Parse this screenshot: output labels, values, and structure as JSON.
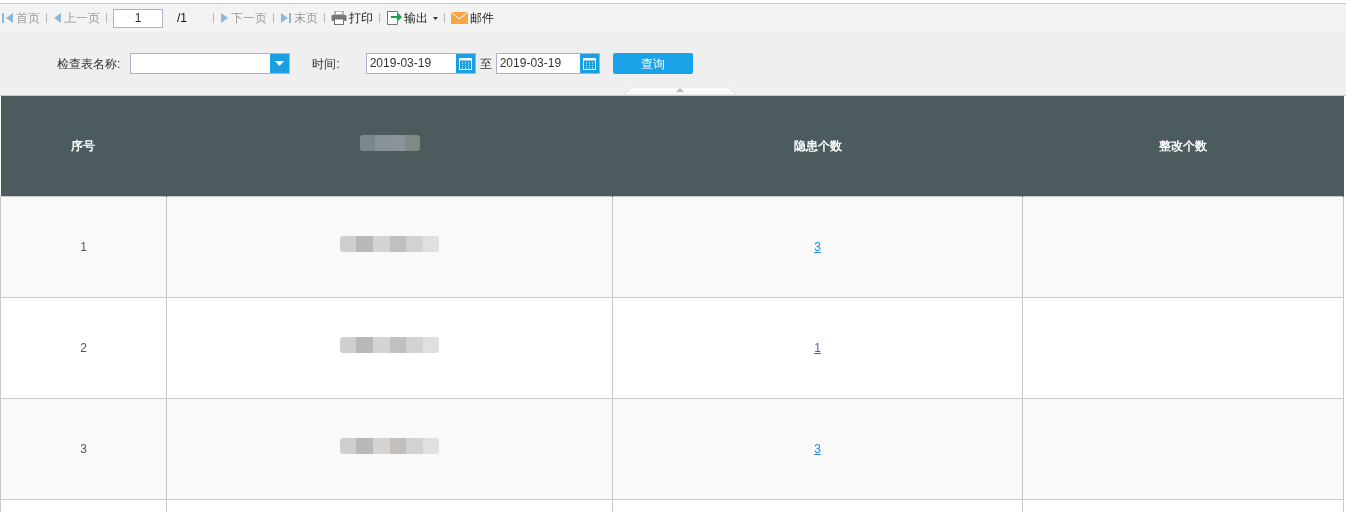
{
  "toolbar": [
    {
      "kind": "first",
      "label": "首页",
      "disabled": true
    },
    {
      "kind": "prev",
      "label": "上一页",
      "disabled": true
    },
    {
      "kind": "page",
      "value": "1",
      "total": "/1"
    },
    {
      "kind": "next",
      "label": "下一页",
      "disabled": true
    },
    {
      "kind": "last",
      "label": "末页",
      "disabled": true
    },
    {
      "kind": "print",
      "label": "打印",
      "disabled": false
    },
    {
      "kind": "export",
      "label": "输出",
      "disabled": false
    },
    {
      "kind": "mail",
      "label": "邮件",
      "disabled": false
    }
  ],
  "filters": {
    "name_label": "检查表名称:",
    "time_label": "时间:",
    "date_from": "2019-03-19",
    "range_sep": "至",
    "date_to": "2019-03-19",
    "query_button": "查询"
  },
  "table": {
    "columns": [
      {
        "label": "序号",
        "redacted": false
      },
      {
        "redacted": true
      },
      {
        "label": "隐患个数",
        "redacted": false
      },
      {
        "label": "整改个数",
        "redacted": false
      }
    ],
    "rows": [
      {
        "index": "1",
        "hazards": "3",
        "visited": false,
        "rectified": ""
      },
      {
        "index": "2",
        "hazards": "1",
        "visited": true,
        "rectified": ""
      },
      {
        "index": "3",
        "hazards": "3",
        "visited": false,
        "rectified": ""
      }
    ]
  }
}
